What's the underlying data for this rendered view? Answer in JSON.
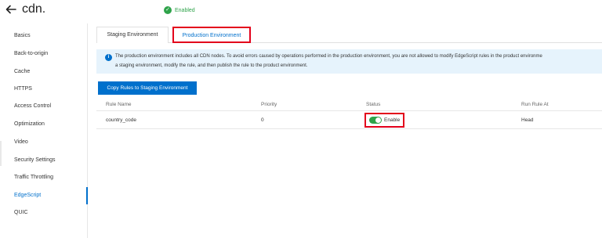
{
  "header": {
    "back_icon": "arrow-left-icon",
    "title": "cdn.",
    "status_icon": "check-circle-icon",
    "status": "Enabled"
  },
  "sidebar": {
    "items": [
      {
        "label": "Basics",
        "active": false
      },
      {
        "label": "Back-to-origin",
        "active": false
      },
      {
        "label": "Cache",
        "active": false
      },
      {
        "label": "HTTPS",
        "active": false
      },
      {
        "label": "Access Control",
        "active": false
      },
      {
        "label": "Optimization",
        "active": false
      },
      {
        "label": "Video",
        "active": false
      },
      {
        "label": "Security Settings",
        "active": false
      },
      {
        "label": "Traffic Throttling",
        "active": false
      },
      {
        "label": "EdgeScript",
        "active": true
      },
      {
        "label": "QUIC",
        "active": false
      }
    ]
  },
  "tabs": [
    {
      "label": "Staging Environment",
      "active": false
    },
    {
      "label": "Production Environment",
      "active": true
    }
  ],
  "notice": {
    "icon": "info-icon",
    "line1": "The production environment includes all CDN nodes. To avoid errors caused by operations performed in the production environment, you are not allowed to modify EdgeScript rules in the product environme",
    "line2": "a staging environment, modify the rule, and then publish the rule to the product environment."
  },
  "actions": {
    "copy_label": "Copy Rules to Staging Environment"
  },
  "table": {
    "headers": [
      "Rule Name",
      "Priority",
      "Status",
      "Run Rule At"
    ],
    "rows": [
      {
        "rule_name": "country_code",
        "priority": "0",
        "status": "Enable",
        "enabled": true,
        "run_rule_at": "Head"
      }
    ]
  },
  "colors": {
    "accent": "#0070cc",
    "success": "#2ea34a",
    "highlight": "#e3001b",
    "notice_bg": "#e6f3fc"
  }
}
